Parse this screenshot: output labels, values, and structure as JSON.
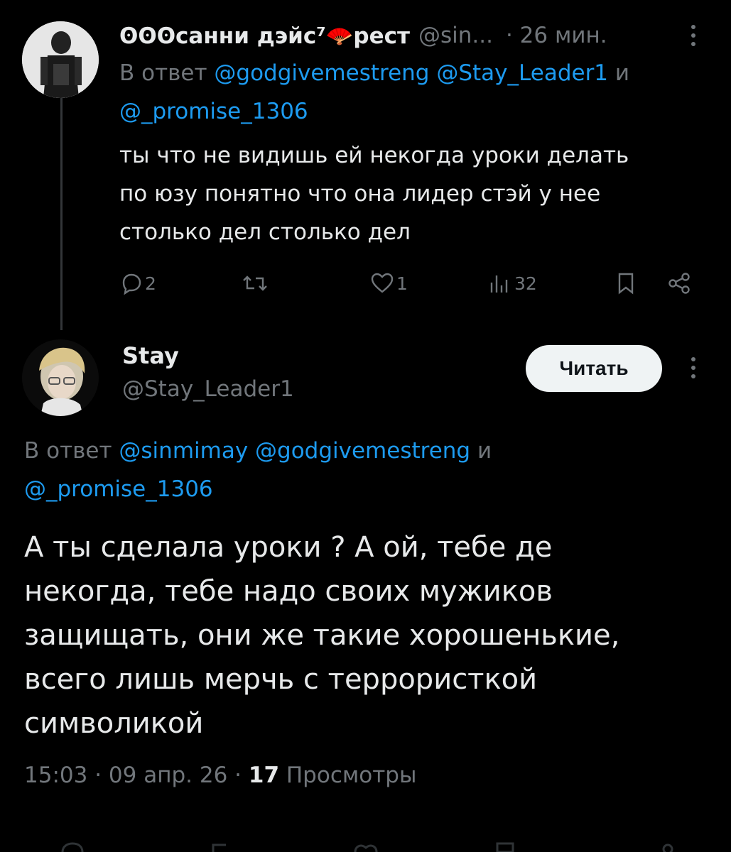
{
  "tweet1": {
    "author_name": "ʘʘʘсанни дэйс⁷🪭рест",
    "handle": "@sin...",
    "time": "· 26 мин.",
    "reply_prefix": "В ответ",
    "reply_mentions": [
      "@godgivemestreng",
      "@Stay_Leader1"
    ],
    "reply_and": "и",
    "reply_last": "@_promise_1306",
    "text_lines": [
      "ты что не видишь ей некогда уроки делать",
      "по юзу понятно что она лидер стэй у нее",
      "столько дел столько дел"
    ],
    "replies_count": "2",
    "likes_count": "1",
    "views_count": "32"
  },
  "tweet2": {
    "author_name": "Stay",
    "handle": "@Stay_Leader1",
    "follow_label": "Читать",
    "reply_prefix": "В ответ",
    "reply_mentions": [
      "@sinmimay",
      "@godgivemestreng"
    ],
    "reply_and": "и",
    "reply_last": "@_promise_1306",
    "text_lines": [
      "А ты сделала уроки ? А ой, тебе де",
      "некогда,  тебе надо своих мужиков",
      "защищать, они же такие хорошенькие,",
      "всего лишь мерчь с террористкой",
      "символикой"
    ],
    "timestamp": "15:03 · 09 апр. 26 ·",
    "views_count": "17",
    "views_label": "Просмотры"
  },
  "colors": {
    "background": "#000000",
    "text": "#e7e9ea",
    "secondary": "#71767b",
    "link": "#1d9bf0",
    "button_bg": "#eff3f4"
  }
}
